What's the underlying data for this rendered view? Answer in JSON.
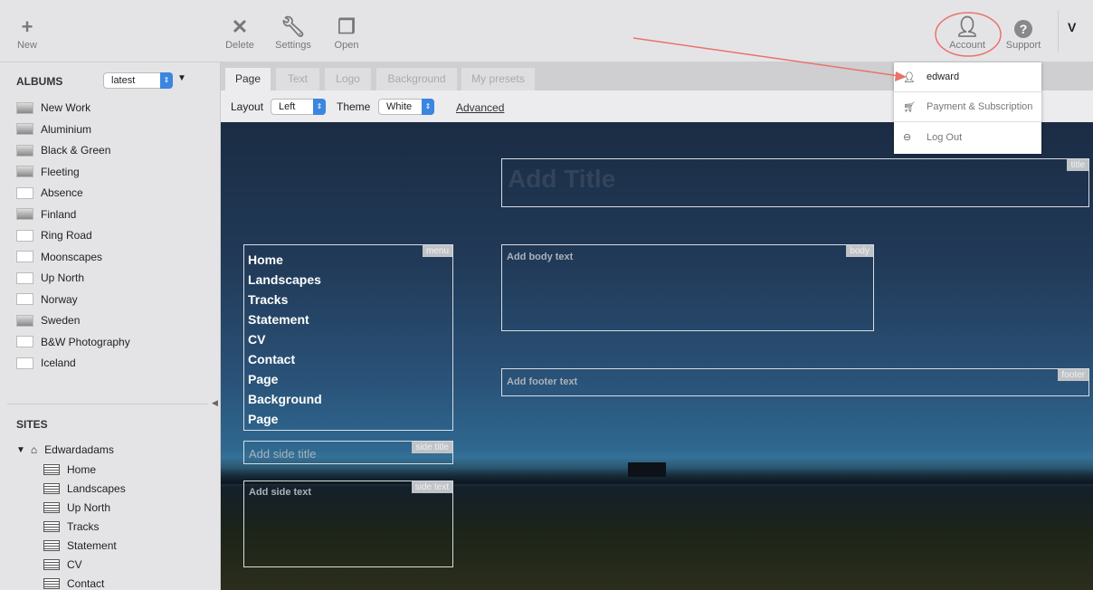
{
  "toolbar": {
    "new": "New",
    "delete": "Delete",
    "settings": "Settings",
    "open": "Open",
    "account": "Account",
    "support": "Support",
    "user_initial": "V"
  },
  "account_menu": {
    "user": "edward",
    "payment": "Payment & Subscription",
    "logout": "Log Out"
  },
  "albums": {
    "heading": "ALBUMS",
    "sort": "latest",
    "items": [
      "New Work",
      "Aluminium",
      "Black & Green",
      "Fleeting",
      "Absence",
      "Finland",
      "Ring Road",
      "Moonscapes",
      "Up North",
      "Norway",
      "Sweden",
      "B&W Photography",
      "Iceland"
    ]
  },
  "sites": {
    "heading": "SITES",
    "site": "Edwardadams",
    "pages": [
      "Home",
      "Landscapes",
      "Up North",
      "Tracks",
      "Statement",
      "CV",
      "Contact"
    ]
  },
  "tabs": [
    "Page",
    "Text",
    "Logo",
    "Background",
    "My presets"
  ],
  "options": {
    "layout_label": "Layout",
    "layout": "Left",
    "theme_label": "Theme",
    "theme": "White",
    "advanced": "Advanced"
  },
  "canvas": {
    "title": {
      "placeholder": "Add Title",
      "tag": "title"
    },
    "menu": {
      "tag": "menu",
      "items": [
        "Home",
        "Landscapes",
        "Tracks",
        "Statement",
        "CV",
        "Contact",
        "Page",
        "Background",
        "Page"
      ]
    },
    "side_title": {
      "placeholder": "Add side title",
      "tag": "side title"
    },
    "side_text": {
      "placeholder": "Add side text",
      "tag": "side text"
    },
    "body": {
      "placeholder": "Add body text",
      "tag": "body"
    },
    "footer": {
      "placeholder": "Add footer text",
      "tag": "footer"
    }
  },
  "colors": {
    "accent": "#3a86e0",
    "annotation": "#e8736b"
  }
}
